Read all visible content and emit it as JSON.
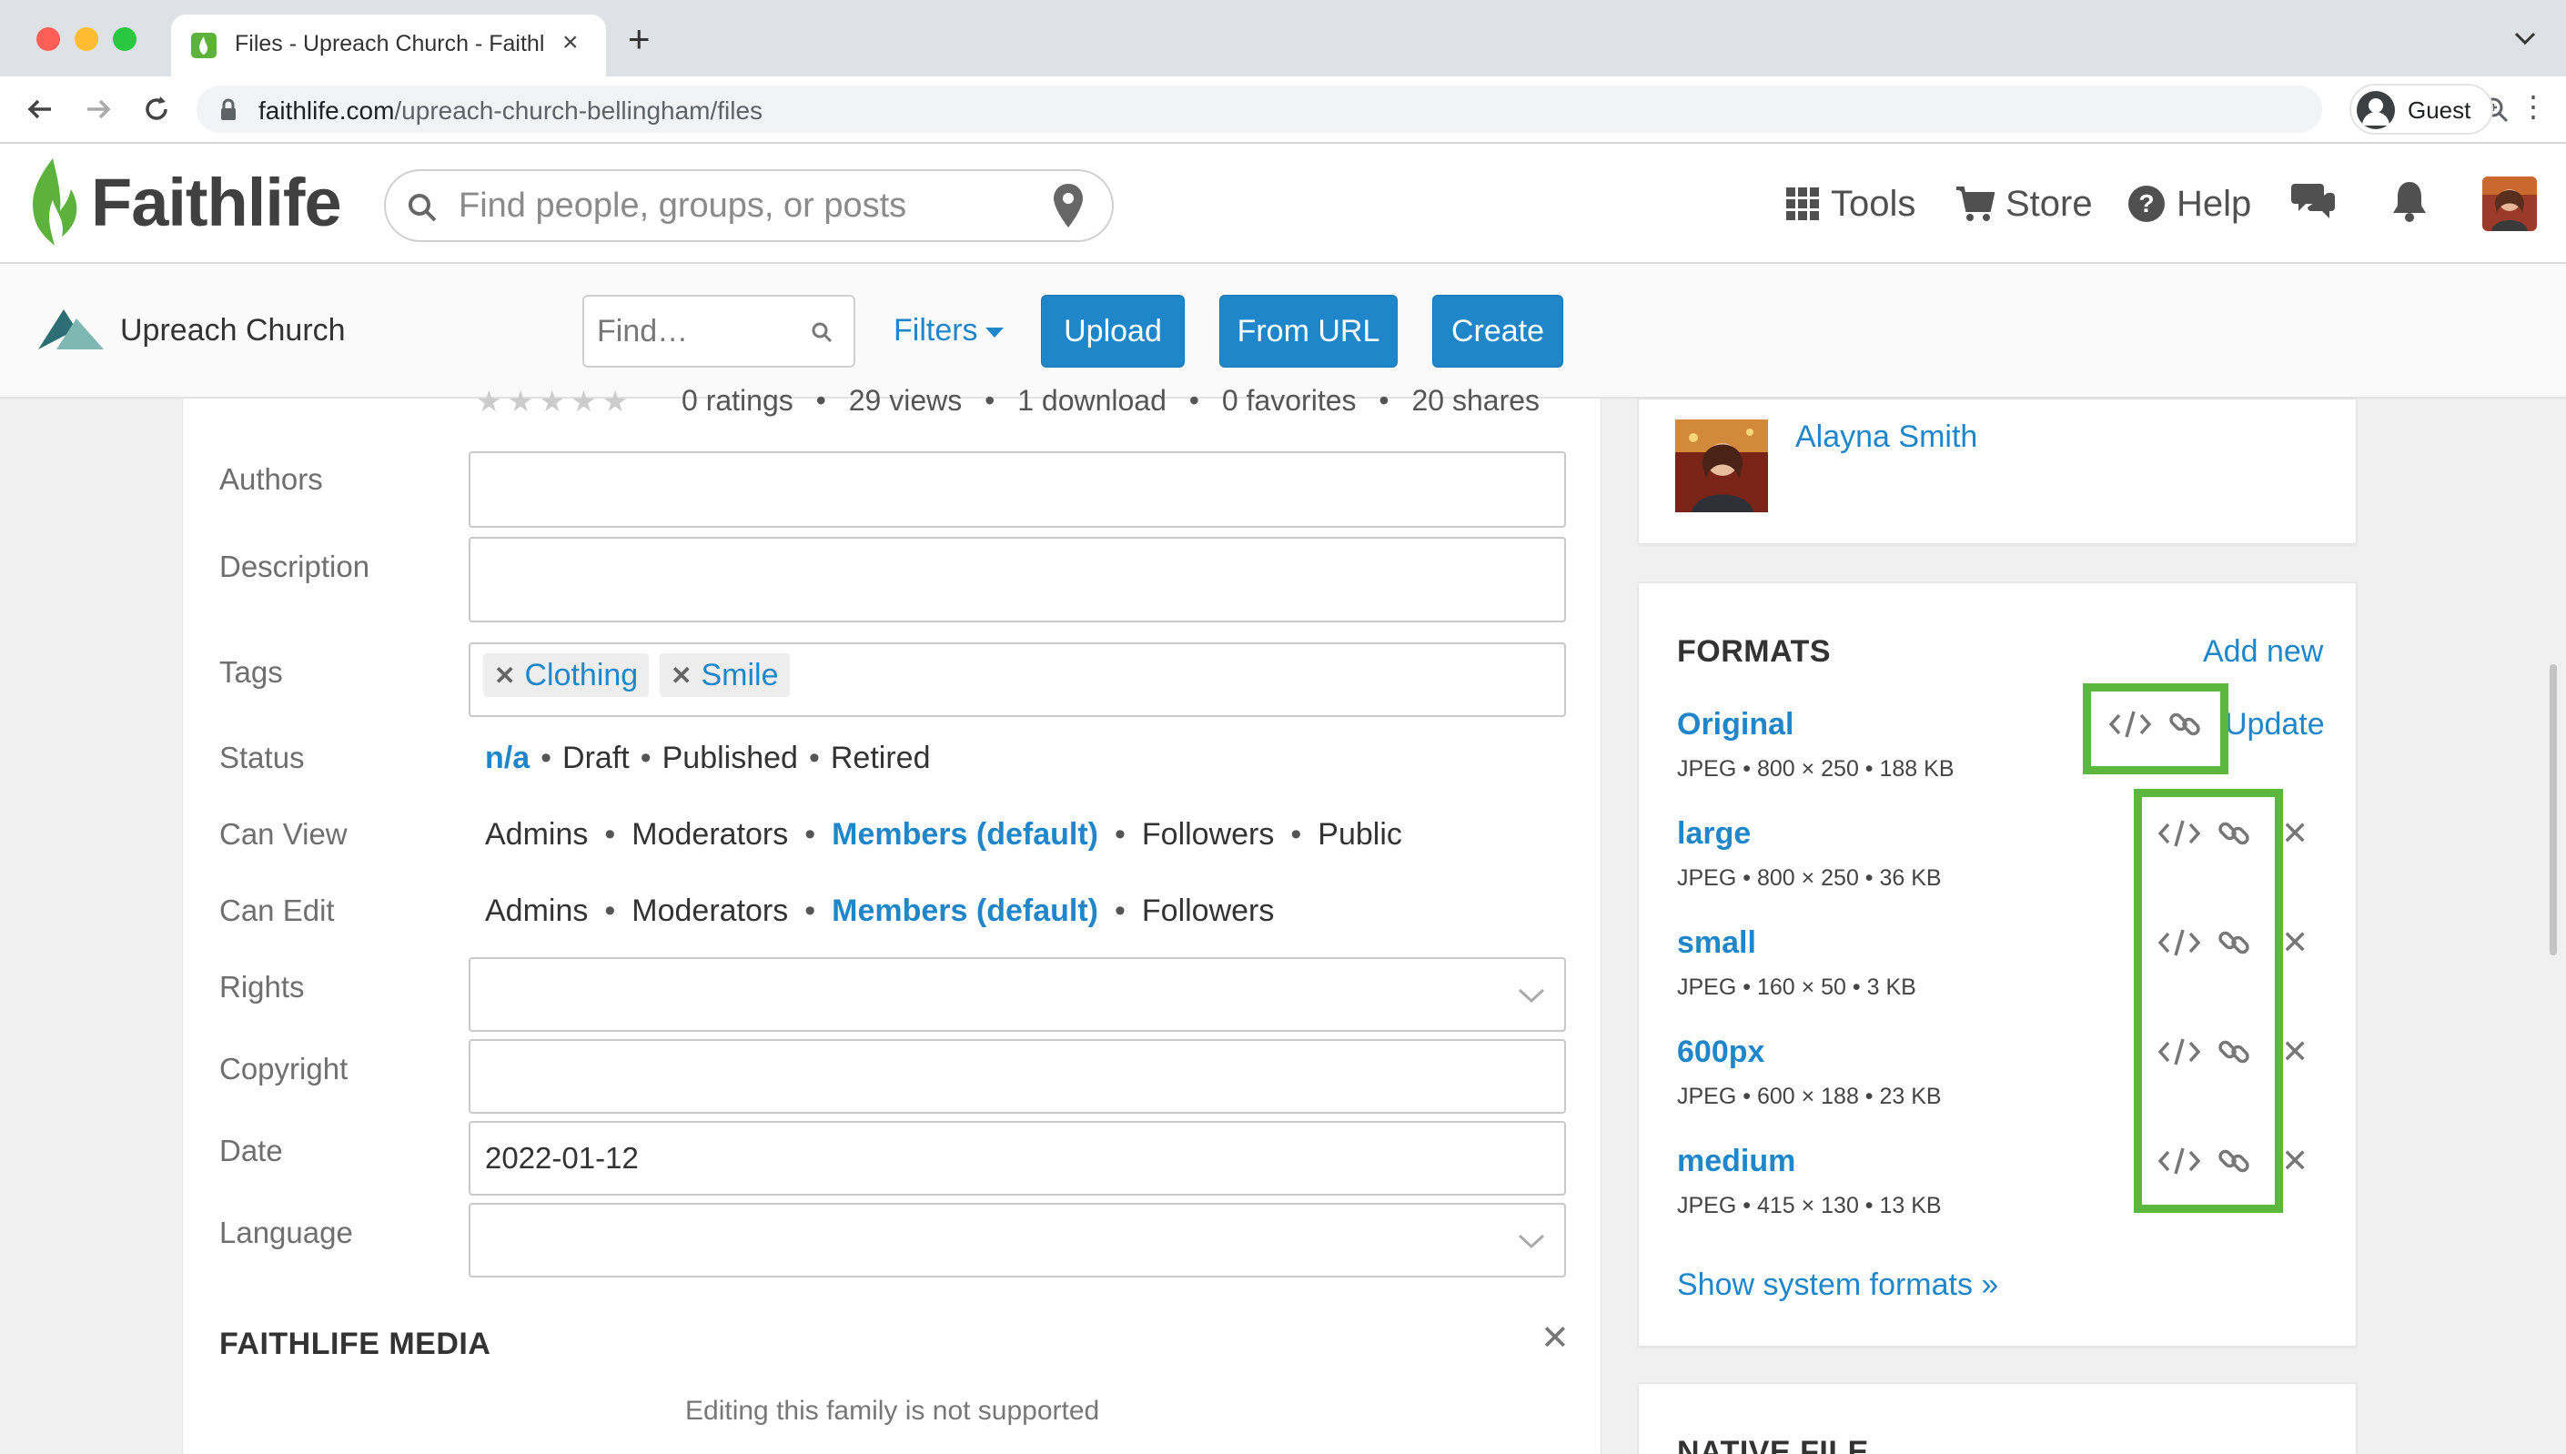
{
  "browser": {
    "tab_title": "Files - Upreach Church - Faithlife",
    "url_host": "faithlife.com",
    "url_path": "/upreach-church-bellingham/files",
    "profile_label": "Guest"
  },
  "header": {
    "logo_text": "Faithlife",
    "search_placeholder": "Find people, groups, or posts",
    "nav": {
      "tools": "Tools",
      "store": "Store",
      "help": "Help"
    }
  },
  "toolbar": {
    "group_name": "Upreach Church",
    "find_placeholder": "Find…",
    "filters_label": "Filters",
    "upload_label": "Upload",
    "from_url_label": "From URL",
    "create_label": "Create"
  },
  "stats": {
    "ratings": "0 ratings",
    "views": "29 views",
    "downloads": "1 download",
    "favorites": "0 favorites",
    "shares": "20 shares"
  },
  "form": {
    "authors_label": "Authors",
    "description_label": "Description",
    "tags_label": "Tags",
    "tags": [
      "Clothing",
      "Smile"
    ],
    "status_label": "Status",
    "status_options": [
      "n/a",
      "Draft",
      "Published",
      "Retired"
    ],
    "status_selected": "n/a",
    "can_view_label": "Can View",
    "can_view_options": [
      "Admins",
      "Moderators",
      "Members (default)",
      "Followers",
      "Public"
    ],
    "can_view_selected": "Members (default)",
    "can_edit_label": "Can Edit",
    "can_edit_options": [
      "Admins",
      "Moderators",
      "Members (default)",
      "Followers"
    ],
    "can_edit_selected": "Members (default)",
    "rights_label": "Rights",
    "copyright_label": "Copyright",
    "date_label": "Date",
    "date_value": "2022-01-12",
    "language_label": "Language"
  },
  "faithlife_media": {
    "title": "FAITHLIFE MEDIA",
    "note": "Editing this family is not supported"
  },
  "author": {
    "name": "Alayna Smith"
  },
  "formats": {
    "title": "FORMATS",
    "add_new": "Add new",
    "update": "Update",
    "items": [
      {
        "name": "Original",
        "meta": "JPEG • 800 × 250 • 188 KB"
      },
      {
        "name": "large",
        "meta": "JPEG • 800 × 250 • 36 KB"
      },
      {
        "name": "small",
        "meta": "JPEG • 160 × 50 • 3 KB"
      },
      {
        "name": "600px",
        "meta": "JPEG • 600 × 188 • 23 KB"
      },
      {
        "name": "medium",
        "meta": "JPEG • 415 × 130 • 13 KB"
      }
    ],
    "show_system": "Show system formats »"
  },
  "native_file": {
    "title": "NATIVE FILE"
  },
  "colors": {
    "link": "#1f86c9",
    "highlight": "#5cb83c",
    "button": "#1f86c9"
  }
}
